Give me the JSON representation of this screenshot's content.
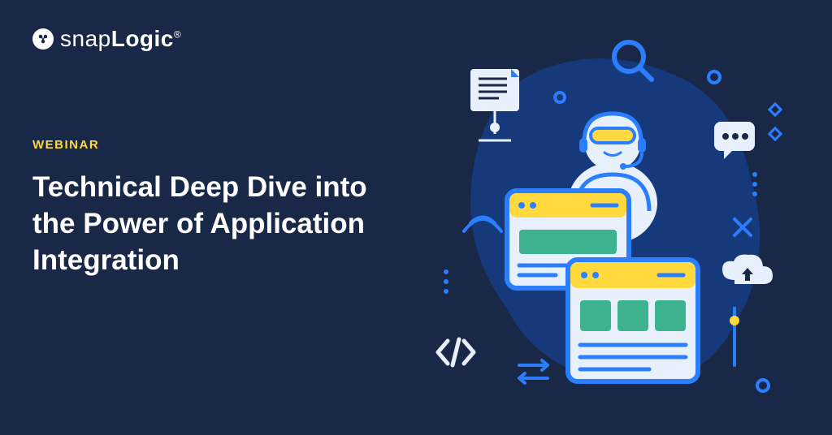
{
  "brand": {
    "name_prefix": "snap",
    "name_suffix": "Logic",
    "registered": "®"
  },
  "content": {
    "eyebrow": "WEBINAR",
    "headline": "Technical Deep Dive into the Power of Application Integration"
  },
  "colors": {
    "background": "#1a2847",
    "accent_yellow": "#ffd93d",
    "accent_blue": "#2b7fff",
    "accent_teal": "#3cb28f",
    "text": "#ffffff"
  }
}
